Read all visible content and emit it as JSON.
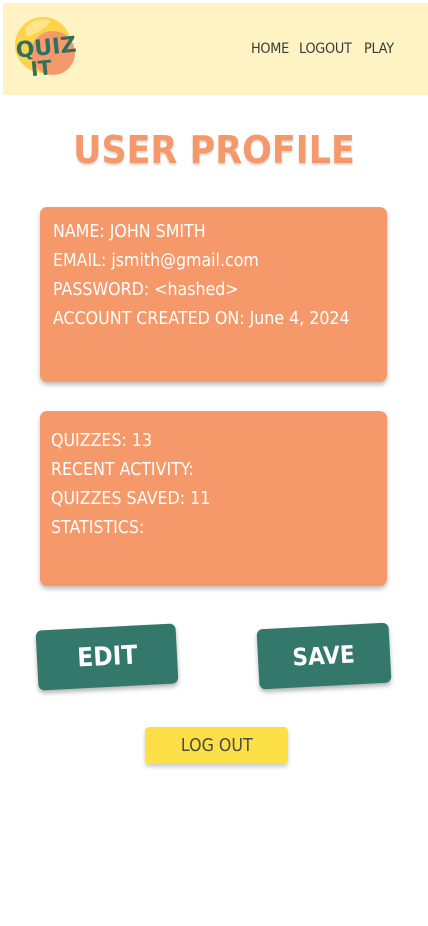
{
  "header": {
    "logo_text": "QUIZ IT",
    "nav": [
      "HOME",
      "LOGOUT",
      "PLAY"
    ]
  },
  "page_title": "USER PROFILE",
  "account_card": {
    "lines": [
      "NAME: JOHN SMITH",
      "EMAIL: jsmith@gmail.com",
      "PASSWORD: <hashed>",
      "ACCOUNT CREATED ON: June 4, 2024"
    ]
  },
  "stats_card": {
    "lines": [
      "QUIZZES: 13",
      "RECENT ACTIVITY:",
      "QUIZZES SAVED: 11",
      "STATISTICS:"
    ]
  },
  "buttons": {
    "edit": "EDIT",
    "save": "SAVE",
    "logout": "LOG OUT"
  },
  "colors": {
    "header_bg": "#fff3c4",
    "accent_orange": "#f5996a",
    "button_green": "#33786b",
    "logout_yellow": "#fde047"
  }
}
